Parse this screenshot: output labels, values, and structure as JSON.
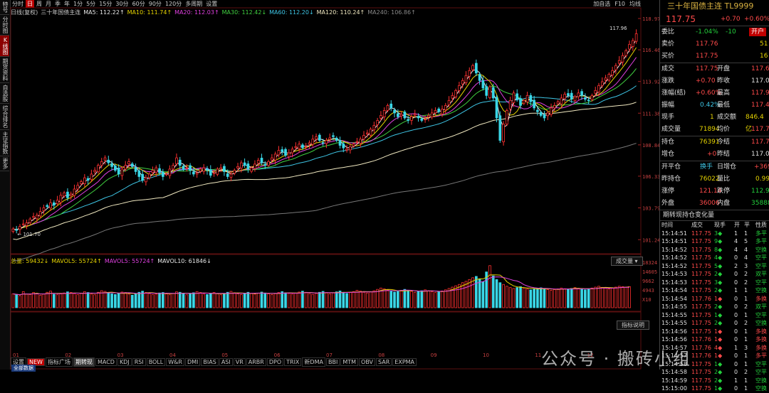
{
  "left_nav": [
    "特 号",
    "分 时 图",
    "K 线 图",
    "期 货 资 料",
    "自 选 股",
    "综 合 排 名",
    "主 证 指 数",
    "更 多"
  ],
  "periods": [
    "分时",
    "日",
    "周",
    "月",
    "季",
    "年",
    "1分",
    "5分",
    "15分",
    "30分",
    "60分",
    "90分",
    "120分",
    "多周期",
    "设置"
  ],
  "active_period": "日",
  "top_right": [
    "加自选",
    "F10",
    "均线"
  ],
  "ma_legend": [
    {
      "text": "日线(复权)",
      "color": "#c8c8c8"
    },
    {
      "text": "三十年国债主连",
      "color": "#c8c8c8"
    },
    {
      "text": "MA5: 112.22↑",
      "color": "#e8e8e8"
    },
    {
      "text": "MA10: 111.74↑",
      "color": "#e6d400"
    },
    {
      "text": "MA20: 112.03↑",
      "color": "#e040e0"
    },
    {
      "text": "MA30: 112.42↓",
      "color": "#40d040"
    },
    {
      "text": "MA60: 112.20↓",
      "color": "#3ec6e6"
    },
    {
      "text": "MA120: 110.24↑",
      "color": "#f0e8c0"
    },
    {
      "text": "MA240: 106.86↑",
      "color": "#888888"
    }
  ],
  "vol_legend": [
    {
      "text": "总量: 59432↓",
      "color": "#e6d400"
    },
    {
      "text": "MAVOL5: 55724↑",
      "color": "#e6d400"
    },
    {
      "text": "MAVOL5: 55724↑",
      "color": "#e040e0"
    },
    {
      "text": "MAVOL10: 61846↓",
      "color": "#e8e8e8"
    }
  ],
  "vol_panel_button": "成交量",
  "indicator_button": "指标说明",
  "annotations": {
    "high": "117.96",
    "low": "101.70"
  },
  "chart_data": {
    "type": "candlestick",
    "y_ticks": [
      "118.97",
      "116.46",
      "113.92",
      "111.38",
      "108.84",
      "106.33",
      "103.79",
      "101.24"
    ],
    "ylim": [
      100.4,
      119.2
    ],
    "x_ticks": [
      "01",
      "02",
      "03",
      "04",
      "05",
      "06",
      "07",
      "08",
      "09",
      "10",
      "11",
      "12"
    ],
    "vol_ticks": [
      "18324",
      "14605",
      "9662",
      "4943",
      "X10"
    ],
    "vol_max": 20000,
    "close": [
      102.1,
      102.0,
      102.3,
      102.5,
      102.6,
      102.9,
      103.1,
      103.2,
      103.5,
      103.8,
      103.9,
      104.2,
      104.0,
      104.4,
      104.8,
      105.0,
      104.6,
      104.9,
      105.3,
      105.6,
      105.9,
      106.2,
      106.0,
      106.5,
      106.8,
      107.2,
      107.5,
      107.8,
      107.4,
      107.1,
      106.8,
      106.5,
      106.9,
      107.2,
      107.5,
      107.1,
      106.7,
      106.3,
      106.0,
      106.2,
      106.5,
      106.8,
      107.0,
      106.6,
      106.3,
      106.5,
      106.9,
      107.2,
      107.8,
      107.2,
      106.9,
      107.0,
      106.8,
      106.5,
      106.6,
      106.9,
      107.0,
      106.8,
      106.4,
      106.6,
      106.9,
      107.0,
      106.7,
      106.3,
      106.5,
      106.8,
      107.1,
      107.4,
      107.2,
      106.9,
      107.0,
      107.3,
      107.6,
      107.4,
      107.2,
      107.5,
      107.8,
      108.1,
      108.4,
      108.3,
      108.0,
      108.2,
      108.5,
      108.7,
      108.9,
      108.6,
      108.7,
      109.0,
      109.3,
      109.5,
      109.2,
      109.0,
      109.2,
      109.4,
      109.5,
      109.2,
      108.8,
      108.6,
      108.5,
      108.7,
      108.9,
      109.1,
      109.3,
      109.6,
      109.8,
      110.1,
      110.4,
      110.8,
      111.2,
      111.6,
      112.0,
      111.8,
      111.4,
      111.1,
      111.3,
      111.0,
      110.8,
      111.1,
      111.3,
      111.0,
      110.8,
      110.9,
      111.2,
      111.4,
      111.6,
      111.5,
      111.7,
      112.0,
      112.4,
      112.8,
      113.2,
      113.6,
      114.0,
      114.4,
      114.8,
      115.2,
      114.6,
      114.0,
      113.4,
      112.8,
      113.5,
      112.6,
      111.0,
      109.2,
      110.5,
      111.6,
      112.4,
      113.0,
      112.5,
      112.0,
      112.4,
      112.8,
      112.3,
      111.8,
      111.5,
      111.2,
      111.0,
      111.4,
      111.8,
      112.0,
      112.3,
      112.6,
      112.9,
      112.8,
      112.5,
      112.7,
      113.0,
      112.8,
      112.5,
      112.4,
      112.8,
      113.2,
      113.6,
      113.9,
      114.2,
      114.5,
      114.8,
      115.2,
      115.6,
      116.0,
      116.4,
      116.9,
      117.2,
      117.75
    ],
    "volume": [
      6200,
      5800,
      5400,
      7200,
      6100,
      5900,
      6800,
      6400,
      5600,
      6100,
      6900,
      7400,
      6000,
      5800,
      6200,
      6600,
      7100,
      6800,
      6300,
      5900,
      6400,
      7200,
      6800,
      6100,
      5800,
      6900,
      7600,
      7300,
      6700,
      6200,
      5900,
      6400,
      7000,
      6800,
      6100,
      5600,
      6200,
      6900,
      7400,
      6800,
      6300,
      5900,
      6100,
      6600,
      6800,
      6200,
      5800,
      6400,
      7100,
      6900,
      6300,
      5800,
      6200,
      6700,
      7200,
      6800,
      6100,
      5900,
      6400,
      6800,
      6300,
      5800,
      6100,
      6900,
      7300,
      6700,
      6200,
      5900,
      6500,
      6900,
      6400,
      6100,
      6500,
      7000,
      6600,
      6200,
      5900,
      6300,
      6800,
      7200,
      6700,
      6400,
      6100,
      6600,
      7000,
      7400,
      6900,
      6300,
      6000,
      6400,
      6900,
      7300,
      6800,
      6200,
      6600,
      7100,
      7500,
      6900,
      6400,
      6800,
      7200,
      7800,
      7400,
      6900,
      6600,
      7100,
      7600,
      8200,
      8800,
      8400,
      7900,
      7400,
      7000,
      7300,
      7800,
      8200,
      7700,
      7300,
      6900,
      7200,
      7600,
      8000,
      7600,
      7200,
      6800,
      7100,
      7500,
      8000,
      8600,
      9200,
      9800,
      10400,
      11200,
      11800,
      12600,
      13400,
      14000,
      12800,
      11600,
      16000,
      18800,
      14200,
      12600,
      11200,
      10400,
      9600,
      9000,
      8600,
      9000,
      9400,
      8800,
      8400,
      8000,
      8300,
      8600,
      8900,
      8500,
      8100,
      7800,
      8100,
      8400,
      8800,
      8500,
      8200,
      8600,
      9000,
      8700,
      8300,
      8000,
      8400,
      8800,
      9200,
      9600,
      9100,
      8700,
      8400,
      8800,
      9200,
      9600,
      9400,
      9100,
      9432
    ]
  },
  "right_panel": {
    "title": "三十年国债主连 TL9999",
    "price": "117.75",
    "change": "+0.70",
    "pct": "+0.60%",
    "rows": [
      [
        {
          "t": "委比",
          "c": "wht",
          "x": 2
        },
        {
          "t": "-1.04%",
          "c": "green",
          "x": 50
        },
        {
          "t": "-10",
          "c": "green",
          "x": 92
        },
        {
          "t": "开户",
          "c": "btn",
          "x": 125
        }
      ],
      [
        {
          "t": "卖价",
          "c": "wht",
          "x": 2
        },
        {
          "t": "117.76",
          "c": "red",
          "x": 50
        },
        {
          "t": "51",
          "c": "yel",
          "x": 140
        }
      ],
      [
        {
          "t": "买价",
          "c": "wht",
          "x": 2
        },
        {
          "t": "117.75",
          "c": "red",
          "x": 50
        },
        {
          "t": "16",
          "c": "yel",
          "x": 140
        }
      ],
      [
        {
          "t": "成交",
          "c": "wht",
          "x": 2
        },
        {
          "t": "117.75",
          "c": "red",
          "x": 50
        },
        {
          "t": "开盘",
          "c": "wht",
          "x": 80
        },
        {
          "t": "117.61",
          "c": "red",
          "x": 128
        }
      ],
      [
        {
          "t": "涨跌",
          "c": "wht",
          "x": 2
        },
        {
          "t": "+0.70",
          "c": "red",
          "x": 50
        },
        {
          "t": "昨收",
          "c": "wht",
          "x": 80
        },
        {
          "t": "117.09",
          "c": "wht",
          "x": 128
        }
      ],
      [
        {
          "t": "涨幅(结)",
          "c": "wht",
          "x": 2
        },
        {
          "t": "+0.60%",
          "c": "red",
          "x": 50
        },
        {
          "t": "最高",
          "c": "wht",
          "x": 80
        },
        {
          "t": "117.96",
          "c": "red",
          "x": 128
        }
      ],
      [
        {
          "t": "振幅",
          "c": "wht",
          "x": 2
        },
        {
          "t": "0.42%",
          "c": "cyan",
          "x": 56
        },
        {
          "t": "最低",
          "c": "wht",
          "x": 80
        },
        {
          "t": "117.47",
          "c": "red",
          "x": 128
        }
      ],
      [
        {
          "t": "现手",
          "c": "wht",
          "x": 2
        },
        {
          "t": "1",
          "c": "yel",
          "x": 70
        },
        {
          "t": "成交额",
          "c": "wht",
          "x": 80
        },
        {
          "t": "846.4亿",
          "c": "yel",
          "x": 120
        }
      ],
      [
        {
          "t": "成交量",
          "c": "wht",
          "x": 2
        },
        {
          "t": "71894",
          "c": "yel",
          "x": 55
        },
        {
          "t": "均价",
          "c": "wht",
          "x": 80
        },
        {
          "t": "117.73",
          "c": "red",
          "x": 128
        }
      ],
      [
        {
          "t": "持仓",
          "c": "wht",
          "x": 2
        },
        {
          "t": "76391",
          "c": "yel",
          "x": 55
        },
        {
          "t": "今结",
          "c": "wht",
          "x": 80
        },
        {
          "t": "117.77",
          "c": "red",
          "x": 128
        }
      ],
      [
        {
          "t": "增仓",
          "c": "wht",
          "x": 2
        },
        {
          "t": "+0",
          "c": "red",
          "x": 66
        },
        {
          "t": "昨结",
          "c": "wht",
          "x": 80
        },
        {
          "t": "117.05",
          "c": "wht",
          "x": 128
        }
      ],
      [
        {
          "t": "开平仓",
          "c": "wht",
          "x": 2
        },
        {
          "t": "换手",
          "c": "cyan",
          "x": 56
        },
        {
          "t": "日增仓",
          "c": "wht",
          "x": 80
        },
        {
          "t": "+369",
          "c": "red",
          "x": 132
        }
      ],
      [
        {
          "t": "昨持仓",
          "c": "wht",
          "x": 2
        },
        {
          "t": "76022",
          "c": "yel",
          "x": 55
        },
        {
          "t": "量比",
          "c": "wht",
          "x": 80
        },
        {
          "t": "0.99",
          "c": "yel",
          "x": 134
        }
      ],
      [
        {
          "t": "涨停",
          "c": "wht",
          "x": 2
        },
        {
          "t": "121.14",
          "c": "red",
          "x": 55
        },
        {
          "t": "跌停",
          "c": "wht",
          "x": 80
        },
        {
          "t": "112.96",
          "c": "green",
          "x": 128
        }
      ],
      [
        {
          "t": "外盘",
          "c": "wht",
          "x": 2
        },
        {
          "t": "36006",
          "c": "red",
          "x": 55
        },
        {
          "t": "内盘",
          "c": "wht",
          "x": 80
        },
        {
          "t": "35888",
          "c": "green",
          "x": 128
        }
      ]
    ],
    "table_title": "期转现持仓变化量",
    "table_headers": [
      "时间",
      "成交",
      "现手",
      "开",
      "平",
      "性质"
    ],
    "ticks": [
      [
        "15:14:51",
        "117.75",
        "3",
        "1",
        "1",
        "多平",
        "g"
      ],
      [
        "15:14:51",
        "117.75",
        "9",
        "4",
        "5",
        "多平",
        "g"
      ],
      [
        "15:14:52",
        "117.75",
        "8",
        "4",
        "4",
        "空换",
        "g"
      ],
      [
        "15:14:52",
        "117.75",
        "4",
        "0",
        "4",
        "空平",
        "g"
      ],
      [
        "15:14:52",
        "117.75",
        "5",
        "2",
        "3",
        "空平",
        "g"
      ],
      [
        "15:14:53",
        "117.75",
        "2",
        "0",
        "2",
        "双平",
        "g"
      ],
      [
        "15:14:53",
        "117.75",
        "3",
        "0",
        "2",
        "空平",
        "g"
      ],
      [
        "15:14:54",
        "117.75",
        "2",
        "1",
        "1",
        "空换",
        "g"
      ],
      [
        "15:14:54",
        "117.76",
        "1",
        "0",
        "1",
        "多换",
        "r"
      ],
      [
        "15:14:55",
        "117.75",
        "2",
        "0",
        "2",
        "双平",
        "g"
      ],
      [
        "15:14:55",
        "117.75",
        "1",
        "0",
        "1",
        "空平",
        "g"
      ],
      [
        "15:14:55",
        "117.75",
        "2",
        "0",
        "2",
        "空换",
        "g"
      ],
      [
        "15:14:56",
        "117.75",
        "1",
        "0",
        "1",
        "多换",
        "r"
      ],
      [
        "15:14:56",
        "117.76",
        "1",
        "0",
        "1",
        "多换",
        "r"
      ],
      [
        "15:14:57",
        "117.76",
        "4",
        "1",
        "3",
        "多换",
        "r"
      ],
      [
        "15:14:57",
        "117.76",
        "1",
        "0",
        "1",
        "多平",
        "r"
      ],
      [
        "15:14:58",
        "117.75",
        "1",
        "0",
        "1",
        "空平",
        "g"
      ],
      [
        "15:14:58",
        "117.75",
        "2",
        "0",
        "2",
        "空平",
        "g"
      ],
      [
        "15:14:59",
        "117.75",
        "2",
        "1",
        "1",
        "空换",
        "g"
      ],
      [
        "15:15:00",
        "117.75",
        "1",
        "0",
        "1",
        "空换",
        "g"
      ]
    ],
    "tab_label": "全部数据"
  },
  "bottom_tabs": [
    "设置",
    "NEW",
    "指标广场",
    "期转现",
    "MACD",
    "KDJ",
    "RSI",
    "BOLL",
    "W&R",
    "DMI",
    "BIAS",
    "ASI",
    "VR",
    "ARBR",
    "DPO",
    "TRIX",
    "新DMA",
    "BBI",
    "MTM",
    "OBV",
    "SAR",
    "EXPMA"
  ],
  "bottom_active": "期转现",
  "watermark": "公众号 · 搬砖小组"
}
